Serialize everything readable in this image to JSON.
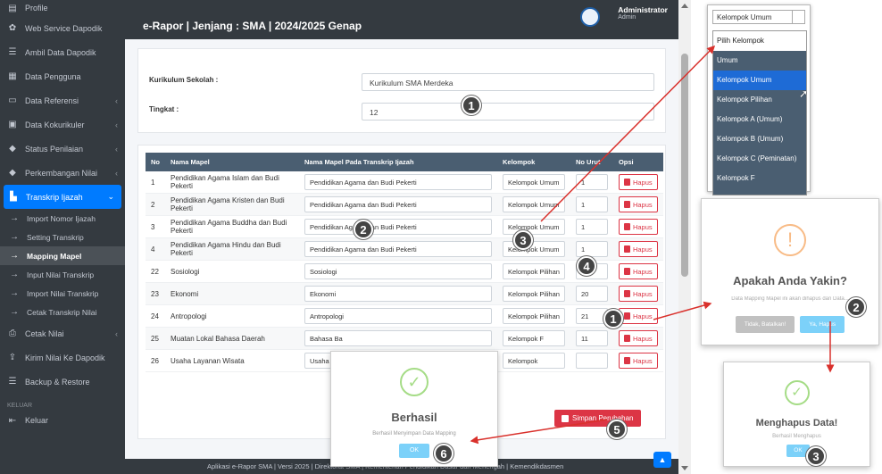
{
  "sidebar": {
    "items": [
      {
        "label": "Profile",
        "icon": "profile-icon"
      },
      {
        "label": "Web Service Dapodik",
        "icon": "gear-icon"
      },
      {
        "label": "Ambil Data Dapodik",
        "icon": "database-icon"
      },
      {
        "label": "Data Pengguna",
        "icon": "user-card-icon"
      },
      {
        "label": "Data Referensi",
        "icon": "monitor-icon"
      },
      {
        "label": "Data Kokurikuler",
        "icon": "board-icon"
      },
      {
        "label": "Status Penilaian",
        "icon": "graduation-icon"
      },
      {
        "label": "Perkembangan Nilai",
        "icon": "graduation-icon"
      },
      {
        "label": "Transkrip Ijazah",
        "icon": "document-icon"
      }
    ],
    "sub": [
      "Import Nomor Ijazah",
      "Setting Transkrip",
      "Mapping Mapel",
      "Input Nilai Transkrip",
      "Import Nilai Transkrip",
      "Cetak Transkrip Nilai"
    ],
    "items2": [
      {
        "label": "Cetak Nilai",
        "icon": "printer-icon"
      },
      {
        "label": "Kirim Nilai Ke Dapodik",
        "icon": "upload-icon"
      },
      {
        "label": "Backup & Restore",
        "icon": "database-icon"
      }
    ],
    "section": "KELUAR",
    "keluar": "Keluar"
  },
  "header": {
    "title": "e-Rapor | Jenjang : SMA | 2024/2025 Genap",
    "user": "Administrator",
    "role": "Admin"
  },
  "form": {
    "kurikulum_label": "Kurikulum Sekolah :",
    "kurikulum_value": "Kurikulum SMA Merdeka",
    "tingkat_label": "Tingkat :",
    "tingkat_value": "12"
  },
  "table": {
    "headers": [
      "No",
      "Nama Mapel",
      "Nama Mapel Pada Transkrip Ijazah",
      "Kelompok",
      "No Urut",
      "Opsi"
    ],
    "rows": [
      {
        "no": "1",
        "nama": "Pendidikan Agama Islam dan Budi Pekerti",
        "transkrip": "Pendidikan Agama dan Budi Pekerti",
        "kelompok": "Kelompok Umum",
        "urut": "1"
      },
      {
        "no": "2",
        "nama": "Pendidikan Agama Kristen dan Budi Pekerti",
        "transkrip": "Pendidikan Agama dan Budi Pekerti",
        "kelompok": "Kelompok Umum",
        "urut": "1"
      },
      {
        "no": "3",
        "nama": "Pendidikan Agama Buddha dan Budi Pekerti",
        "transkrip": "Pendidikan Agama dan Budi Pekerti",
        "kelompok": "Kelompok Umum",
        "urut": "1"
      },
      {
        "no": "4",
        "nama": "Pendidikan Agama Hindu dan Budi Pekerti",
        "transkrip": "Pendidikan Agama dan Budi Pekerti",
        "kelompok": "Kelompok Umum",
        "urut": "1"
      },
      {
        "no": "22",
        "nama": "Sosiologi",
        "transkrip": "Sosiologi",
        "kelompok": "Kelompok Pilihan",
        "urut": "19"
      },
      {
        "no": "23",
        "nama": "Ekonomi",
        "transkrip": "Ekonomi",
        "kelompok": "Kelompok Pilihan",
        "urut": "20"
      },
      {
        "no": "24",
        "nama": "Antropologi",
        "transkrip": "Antropologi",
        "kelompok": "Kelompok Pilihan",
        "urut": "21"
      },
      {
        "no": "25",
        "nama": "Muatan Lokal Bahasa Daerah",
        "transkrip": "Bahasa Ba",
        "kelompok": "Kelompok F",
        "urut": "11"
      },
      {
        "no": "26",
        "nama": "Usaha Layanan Wisata",
        "transkrip": "Usaha Lay",
        "kelompok": "Kelompok",
        "urut": ""
      }
    ],
    "hapus_label": "Hapus",
    "simpan_label": "Simpan Perubahan"
  },
  "footer": "Aplikasi e-Rapor SMA | Versi 2025 | Direktorat SMA | Kementerian Pendidikan Dasar dan Menengah | Kemendikdasmen",
  "dropdown": {
    "selected": "Kelompok Umum",
    "options": [
      "Pilih Kelompok",
      "Umum",
      "Kelompok Umum",
      "Kelompok Pilihan",
      "Kelompok A (Umum)",
      "Kelompok B (Umum)",
      "Kelompok C (Peminatan)",
      "Kelompok F"
    ]
  },
  "confirm": {
    "title": "Apakah Anda Yakin?",
    "text": "Data Mapping Mapel ini akan dihapus dan Data...",
    "cancel": "Tidak, Batalkan!",
    "ok": "Ya, Hapus"
  },
  "success": {
    "title": "Berhasil",
    "text": "Berhasil Menyimpan Data Mapping",
    "ok": "OK"
  },
  "deleted": {
    "title": "Menghapus Data!",
    "text": "Berhasil Menghapus",
    "ok": "OK"
  },
  "badges": {
    "b1": "1",
    "b2": "2",
    "b3": "3",
    "b4": "4",
    "b5": "5",
    "b6": "6"
  },
  "colors": {
    "sidebar": "#343a40",
    "accent": "#007bff",
    "danger": "#dc3545",
    "tablehead": "#4a5e71",
    "success": "#a5dc86",
    "warning": "#f8bb86",
    "arrow": "#d9312c"
  }
}
